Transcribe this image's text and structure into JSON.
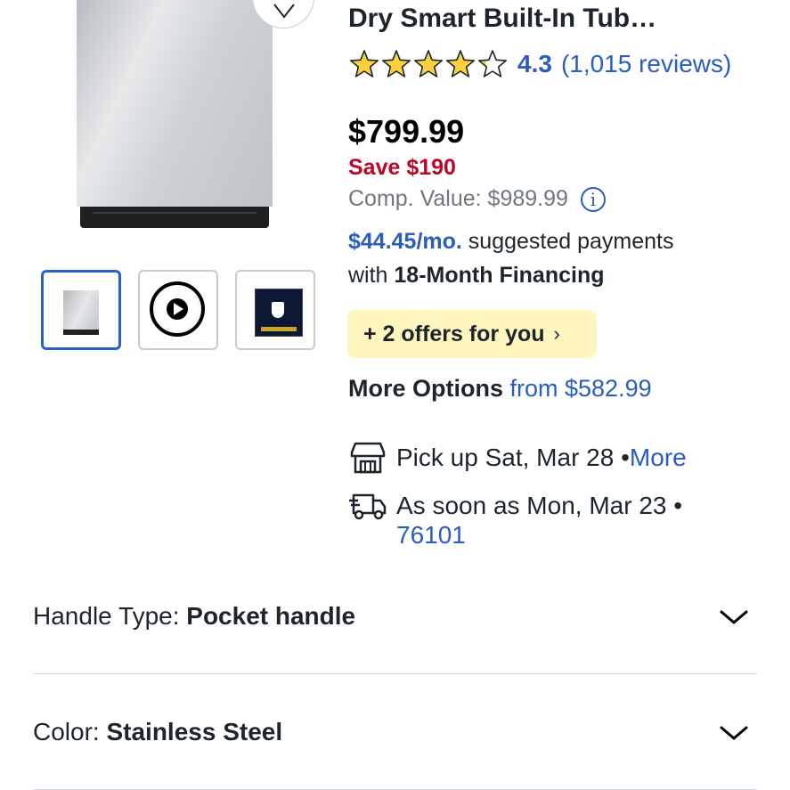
{
  "product": {
    "title": "Dry Smart Built-In Tub…",
    "rating_value": "4.3",
    "rating_count": "(1,015 reviews)",
    "rating_stars": 4.3,
    "price": "$799.99",
    "save": "Save $190",
    "comp_value": "Comp. Value: $989.99",
    "info_glyph": "i"
  },
  "financing": {
    "monthly": "$44.45/mo.",
    "suggested": " suggested payments",
    "with": "with ",
    "term": "18-Month Financing"
  },
  "offers": {
    "label": "+ 2 offers for you",
    "chevron": "›"
  },
  "more_options": {
    "label": "More Options",
    "from": " from $582.99"
  },
  "fulfillment": {
    "pickup_text": "Pick up Sat, Mar 28 • ",
    "pickup_link": "More",
    "delivery_text": "As soon as Mon, Mar 23 •",
    "delivery_zip": "76101"
  },
  "gallery": {
    "thumbnails": [
      "product-image",
      "video",
      "warranty-image"
    ],
    "active_index": 0
  },
  "specs": [
    {
      "label": "Handle Type: ",
      "value": "Pocket handle"
    },
    {
      "label": "Color: ",
      "value": "Stainless Steel"
    }
  ],
  "colors": {
    "accent_blue": "#2a5dbc",
    "save_red": "#bb0628",
    "offers_bg": "#fff6bf",
    "star_gold": "#fcd13b"
  }
}
